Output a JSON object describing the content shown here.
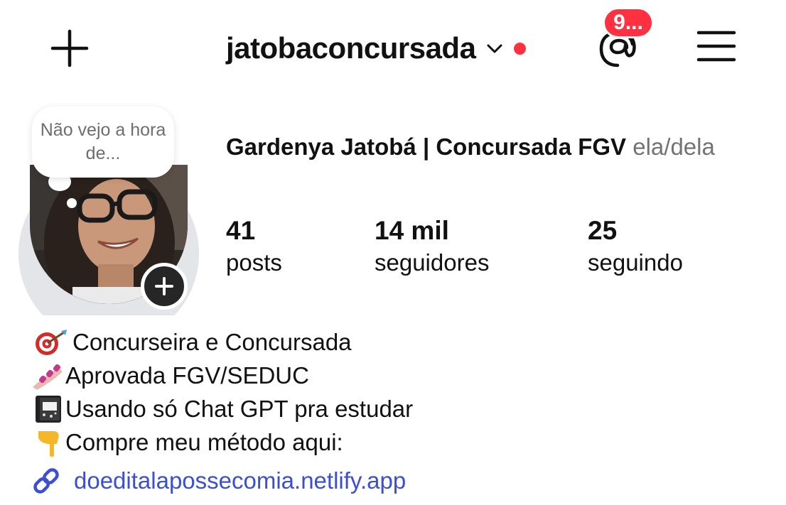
{
  "colors": {
    "accent_red": "#ff3040",
    "link_blue": "#3b4fd4",
    "text_primary": "#111111",
    "text_secondary": "#737373"
  },
  "header": {
    "create_icon": "plus-icon",
    "username": "jatobaconcursada",
    "switch_icon": "chevron-down-icon",
    "threads_icon": "threads-icon",
    "threads_badge": "9...",
    "menu_icon": "hamburger-menu-icon"
  },
  "profile": {
    "note_text": "Não vejo a hora de...",
    "avatar_add_icon": "plus-icon",
    "display_name": "Gardenya Jatobá | Concursada FGV",
    "pronouns": "ela/dela",
    "stats": [
      {
        "value": "41",
        "label": "posts"
      },
      {
        "value": "14 mil",
        "label": "seguidores"
      },
      {
        "value": "25",
        "label": "seguindo"
      }
    ]
  },
  "bio": {
    "lines": [
      {
        "emoji": "target-emoji",
        "text": " Concurseira e Concursada"
      },
      {
        "emoji": "nail-polish-emoji",
        "text": "Aprovada FGV/SEDUC"
      },
      {
        "emoji": "notebook-emoji",
        "text": "Usando só Chat GPT pra estudar"
      },
      {
        "emoji": "pointing-down-emoji",
        "text": "Compre meu método aqui:"
      }
    ],
    "link_icon": "link-icon",
    "link": "doeditalapossecomia.netlify.app"
  }
}
